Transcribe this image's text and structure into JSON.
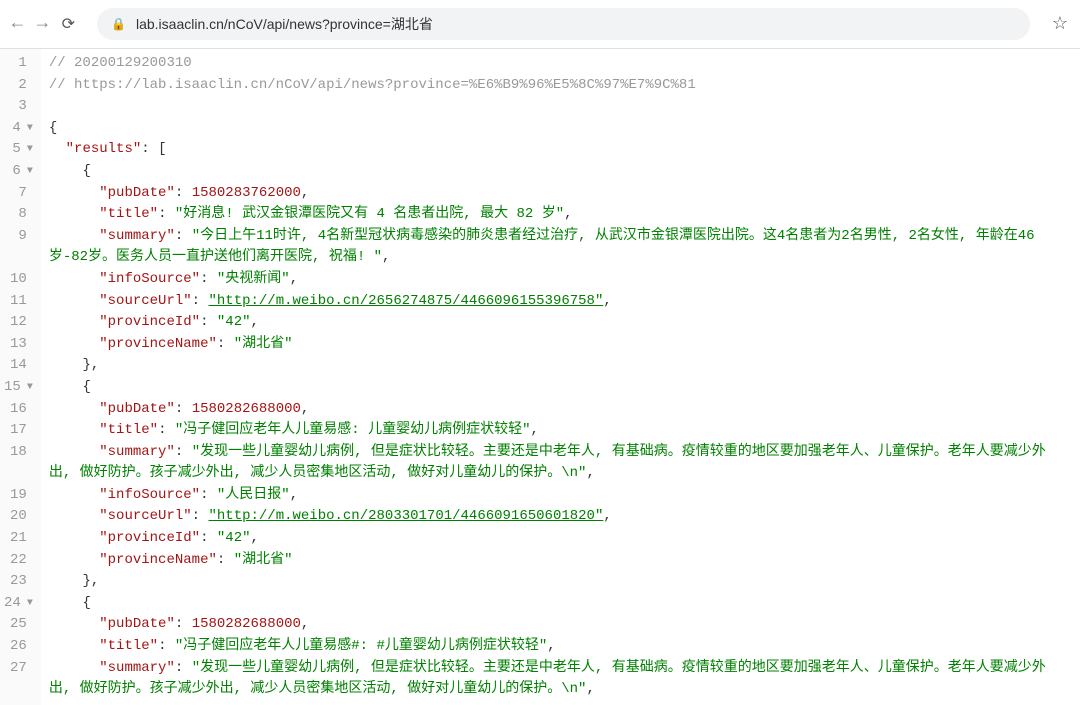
{
  "browser": {
    "url": "lab.isaaclin.cn/nCoV/api/news?province=湖北省"
  },
  "code": {
    "comment1": "// 20200129200310",
    "comment2": "// https://lab.isaaclin.cn/nCoV/api/news?province=%E6%B9%96%E5%8C%97%E7%9C%81",
    "key_results": "\"results\"",
    "results": [
      {
        "pubDate": "1580283762000",
        "title": "\"好消息! 武汉金银潭医院又有 4 名患者出院, 最大 82 岁\"",
        "summary_part1": "\"今日上午11时许, 4名新型冠状病毒感染的肺炎患者经过治疗, 从武汉市金银潭医院出院。这4名患者为2名男性, 2名女性, 年龄在46",
        "summary_part2": "岁-82岁。医务人员一直护送他们离开医院, 祝福! \"",
        "infoSource": "\"央视新闻\"",
        "sourceUrl": "\"http://m.weibo.cn/2656274875/4466096155396758\"",
        "provinceId": "\"42\"",
        "provinceName": "\"湖北省\""
      },
      {
        "pubDate": "1580282688000",
        "title": "\"冯子健回应老年人儿童易感: 儿童婴幼儿病例症状较轻\"",
        "summary_part1": "\"发现一些儿童婴幼儿病例, 但是症状比较轻。主要还是中老年人, 有基础病。疫情较重的地区要加强老年人、儿童保护。老年人要减少外",
        "summary_part2": "出, 做好防护。孩子减少外出, 减少人员密集地区活动, 做好对儿童幼儿的保护。\\n\"",
        "infoSource": "\"人民日报\"",
        "sourceUrl": "\"http://m.weibo.cn/2803301701/4466091650601820\"",
        "provinceId": "\"42\"",
        "provinceName": "\"湖北省\""
      },
      {
        "pubDate": "1580282688000",
        "title": "\"冯子健回应老年人儿童易感#: #儿童婴幼儿病例症状较轻\"",
        "summary_part1": "\"发现一些儿童婴幼儿病例, 但是症状比较轻。主要还是中老年人, 有基础病。疫情较重的地区要加强老年人、儿童保护。老年人要减少外",
        "summary_part2": "出, 做好防护。孩子减少外出, 减少人员密集地区活动, 做好对儿童幼儿的保护。\\n\""
      }
    ],
    "keys": {
      "pubDate": "\"pubDate\"",
      "title": "\"title\"",
      "summary": "\"summary\"",
      "infoSource": "\"infoSource\"",
      "sourceUrl": "\"sourceUrl\"",
      "provinceId": "\"provinceId\"",
      "provinceName": "\"provinceName\""
    },
    "gutterLines": [
      {
        "n": "1",
        "fold": ""
      },
      {
        "n": "2",
        "fold": ""
      },
      {
        "n": "3",
        "fold": ""
      },
      {
        "n": "4",
        "fold": "▼"
      },
      {
        "n": "5",
        "fold": "▼"
      },
      {
        "n": "6",
        "fold": "▼"
      },
      {
        "n": "7",
        "fold": ""
      },
      {
        "n": "8",
        "fold": ""
      },
      {
        "n": "9",
        "fold": ""
      },
      {
        "n": "",
        "fold": ""
      },
      {
        "n": "10",
        "fold": ""
      },
      {
        "n": "11",
        "fold": ""
      },
      {
        "n": "12",
        "fold": ""
      },
      {
        "n": "13",
        "fold": ""
      },
      {
        "n": "14",
        "fold": ""
      },
      {
        "n": "15",
        "fold": "▼"
      },
      {
        "n": "16",
        "fold": ""
      },
      {
        "n": "17",
        "fold": ""
      },
      {
        "n": "18",
        "fold": ""
      },
      {
        "n": "",
        "fold": ""
      },
      {
        "n": "19",
        "fold": ""
      },
      {
        "n": "20",
        "fold": ""
      },
      {
        "n": "21",
        "fold": ""
      },
      {
        "n": "22",
        "fold": ""
      },
      {
        "n": "23",
        "fold": ""
      },
      {
        "n": "24",
        "fold": "▼"
      },
      {
        "n": "25",
        "fold": ""
      },
      {
        "n": "26",
        "fold": ""
      },
      {
        "n": "27",
        "fold": ""
      },
      {
        "n": "",
        "fold": ""
      }
    ]
  }
}
